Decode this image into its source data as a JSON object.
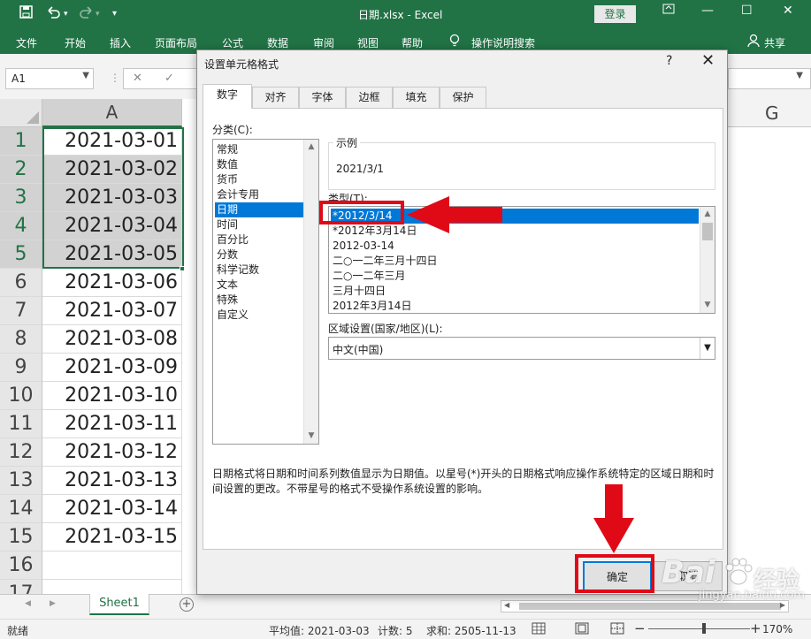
{
  "titlebar": {
    "filename": "日期.xlsx  -  Excel",
    "login": "登录",
    "save_icon": "save-icon",
    "undo_icon": "undo-icon",
    "redo_icon": "redo-icon",
    "min": "—",
    "restore": "☐",
    "close": "✕"
  },
  "ribbon": {
    "tabs": [
      "文件",
      "开始",
      "插入",
      "页面布局",
      "公式",
      "数据",
      "审阅",
      "视图",
      "帮助"
    ],
    "tellme": "操作说明搜索",
    "share": "共享"
  },
  "formula": {
    "namebox": "A1",
    "cancel": "✕",
    "enter": "✓"
  },
  "sheet": {
    "col_a": "A",
    "col_g": "G",
    "rows": [
      {
        "num": "1",
        "value": "2021-03-01"
      },
      {
        "num": "2",
        "value": "2021-03-02"
      },
      {
        "num": "3",
        "value": "2021-03-03"
      },
      {
        "num": "4",
        "value": "2021-03-04"
      },
      {
        "num": "5",
        "value": "2021-03-05"
      },
      {
        "num": "6",
        "value": "2021-03-06"
      },
      {
        "num": "7",
        "value": "2021-03-07"
      },
      {
        "num": "8",
        "value": "2021-03-08"
      },
      {
        "num": "9",
        "value": "2021-03-09"
      },
      {
        "num": "10",
        "value": "2021-03-10"
      },
      {
        "num": "11",
        "value": "2021-03-11"
      },
      {
        "num": "12",
        "value": "2021-03-12"
      },
      {
        "num": "13",
        "value": "2021-03-13"
      },
      {
        "num": "14",
        "value": "2021-03-14"
      },
      {
        "num": "15",
        "value": "2021-03-15"
      },
      {
        "num": "16",
        "value": ""
      },
      {
        "num": "17",
        "value": ""
      }
    ],
    "tab": "Sheet1",
    "add": "+"
  },
  "status": {
    "ready": "就绪",
    "average": "平均值: 2021-03-03",
    "count": "计数: 5",
    "sum": "求和: 2505-11-13",
    "zoom": "170%",
    "minus": "−",
    "plus": "+"
  },
  "dialog": {
    "title": "设置单元格格式",
    "help": "?",
    "close": "✕",
    "tabs": [
      "数字",
      "对齐",
      "字体",
      "边框",
      "填充",
      "保护"
    ],
    "category_label": "分类(C):",
    "categories": [
      "常规",
      "数值",
      "货币",
      "会计专用",
      "日期",
      "时间",
      "百分比",
      "分数",
      "科学记数",
      "文本",
      "特殊",
      "自定义"
    ],
    "sample_label": "示例",
    "sample_value": "2021/3/1",
    "type_label": "类型(T):",
    "types": [
      "*2012/3/14",
      "*2012年3月14日",
      "2012-03-14",
      "二○一二年三月十四日",
      "二○一二年三月",
      "三月十四日",
      "2012年3月14日"
    ],
    "locale_label": "区域设置(国家/地区)(L):",
    "locale_value": "中文(中国)",
    "description": "日期格式将日期和时间系列数值显示为日期值。以星号(*)开头的日期格式响应操作系统特定的区域日期和时间设置的更改。不带星号的格式不受操作系统设置的影响。",
    "ok": "确定",
    "cancel": "取消"
  },
  "watermark": {
    "brand": "Bai",
    "brand2": "经验",
    "url": "jingyan.baidu.com"
  },
  "colors": {
    "excel_green": "#217346",
    "selection_blue": "#0078d7",
    "annotation_red": "#e00a17"
  }
}
